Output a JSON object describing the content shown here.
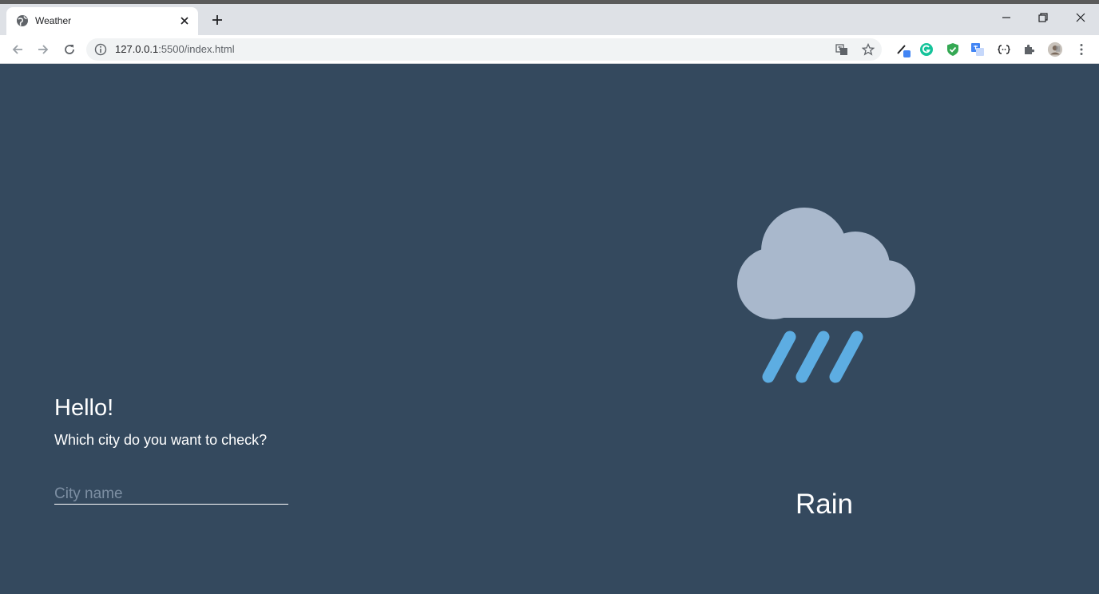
{
  "browser": {
    "tab_title": "Weather",
    "url_host": "127.0.0.1",
    "url_rest": ":5500/index.html"
  },
  "page": {
    "greeting": "Hello!",
    "question": "Which city do you want to check?",
    "city_placeholder": "City name",
    "city_value": "",
    "condition": "Rain",
    "weather_icon": "cloud-rain-icon"
  },
  "colors": {
    "background": "#34495e",
    "cloud": "#a9b8cc",
    "rain": "#5dade2"
  }
}
